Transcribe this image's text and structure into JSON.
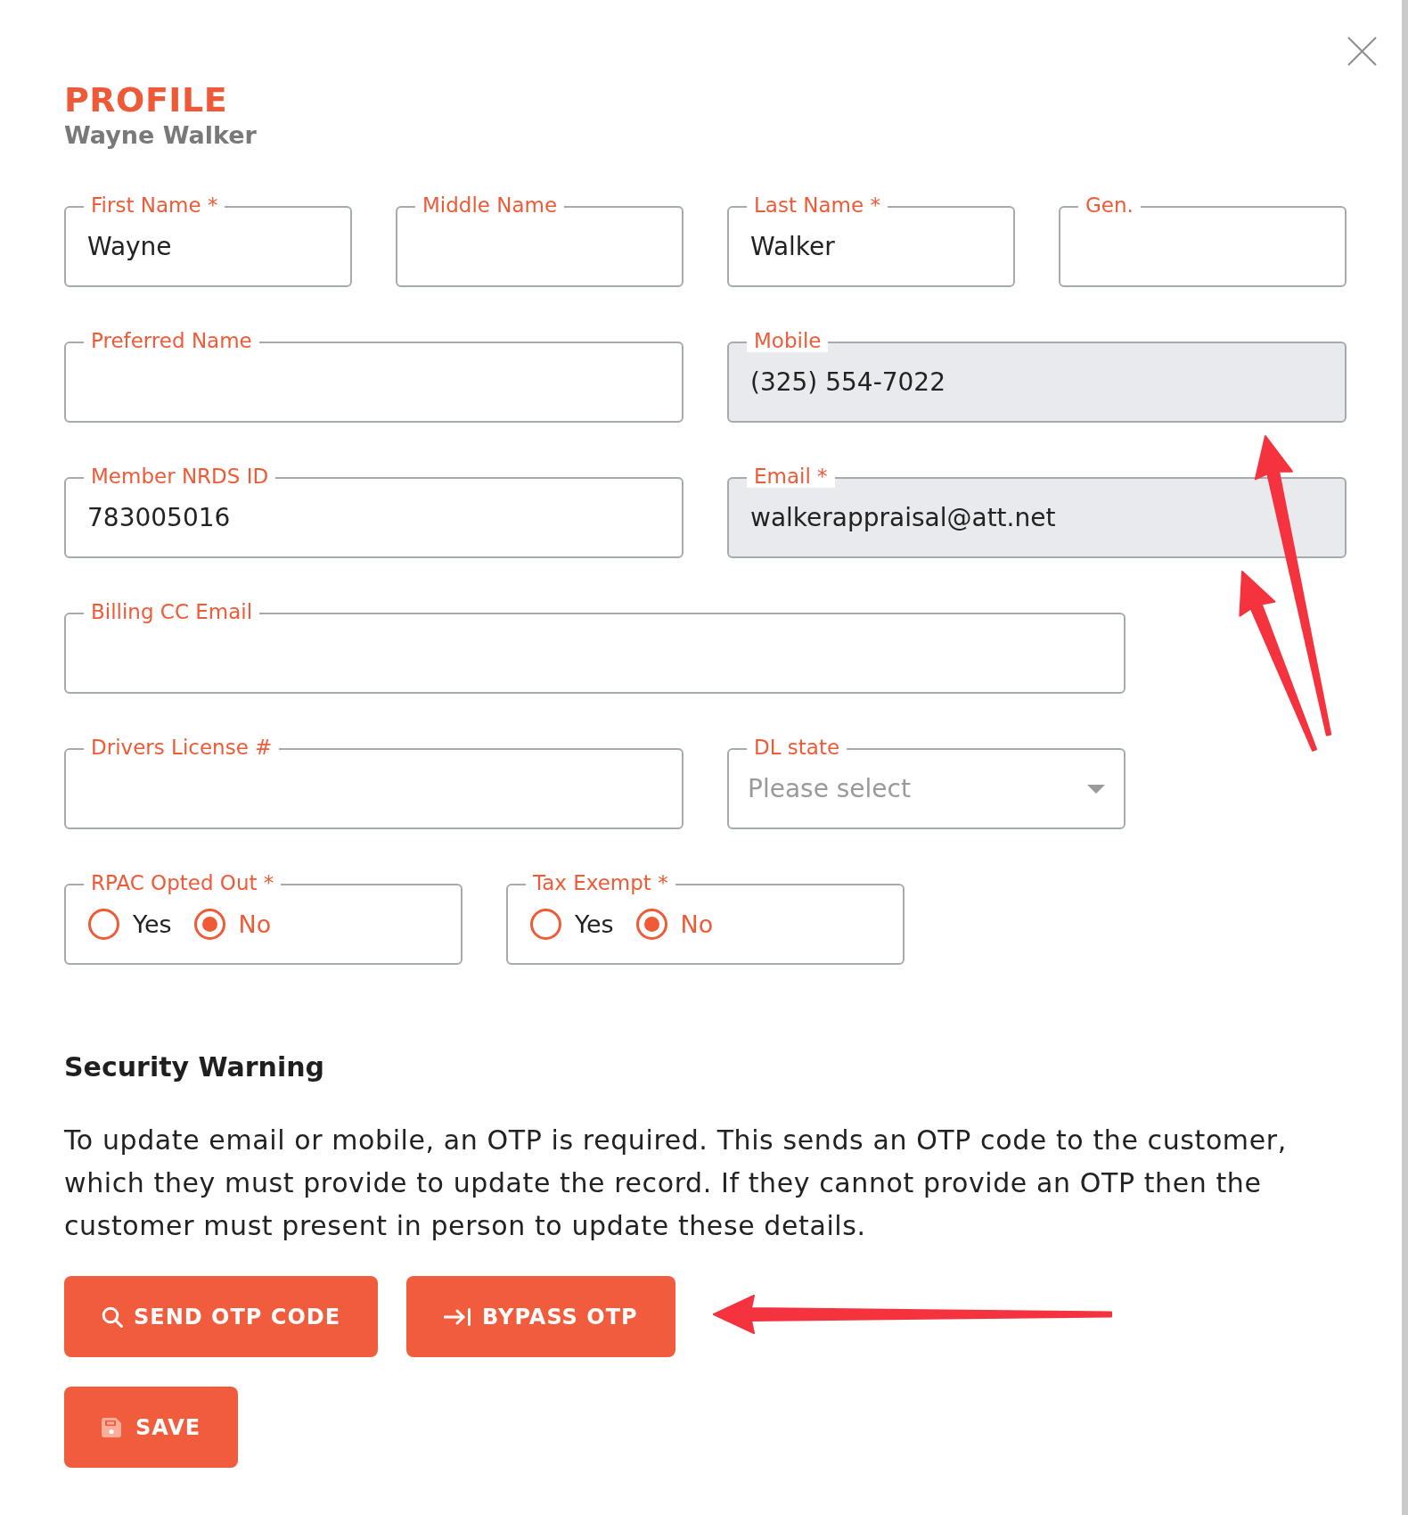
{
  "header": {
    "title": "PROFILE",
    "subtitle": "Wayne Walker"
  },
  "form_rows": [
    {
      "fields": [
        {
          "kind": "text",
          "label": "First Name *",
          "value": "Wayne",
          "disabled": false
        },
        {
          "kind": "text",
          "label": "Middle Name",
          "disabled": false
        },
        {
          "kind": "text",
          "label": "Last Name *",
          "value": "Walker",
          "disabled": false
        },
        {
          "kind": "text",
          "label": "Gen.",
          "disabled": false
        }
      ]
    },
    {
      "fields": [
        {
          "kind": "text",
          "label": "Preferred Name",
          "disabled": false
        },
        {
          "kind": "text",
          "label": "Mobile",
          "value": "(325) 554-7022",
          "disabled": true
        }
      ]
    },
    {
      "fields": [
        {
          "kind": "text",
          "label": "Member NRDS ID",
          "value": "783005016",
          "disabled": false
        },
        {
          "kind": "text",
          "label": "Email *",
          "value": "walkerappraisal@att.net",
          "disabled": true
        }
      ]
    },
    {
      "fields": [
        {
          "kind": "text",
          "label": "Billing CC Email",
          "disabled": false
        }
      ]
    },
    {
      "fields": [
        {
          "kind": "text",
          "label": "Drivers License #",
          "disabled": false
        },
        {
          "kind": "select",
          "label": "DL state",
          "placeholder": "Please select",
          "disabled": false
        }
      ]
    },
    {
      "fields": [
        {
          "kind": "radio",
          "label": "RPAC Opted Out *",
          "options": [
            {
              "label": "Yes",
              "selected": false
            },
            {
              "label": "No",
              "selected": true
            }
          ]
        },
        {
          "kind": "radio",
          "label": "Tax Exempt *",
          "options": [
            {
              "label": "Yes",
              "selected": false
            },
            {
              "label": "No",
              "selected": true
            }
          ]
        }
      ]
    }
  ],
  "security_warning": {
    "title": "Security Warning",
    "text": "To update email or mobile, an OTP is required. This sends an OTP code to the customer, which they must provide to update the record. If they cannot provide an OTP then the customer must present in person to update these details."
  },
  "otp_actions": [
    {
      "kind": "send",
      "label": "SEND OTP CODE"
    },
    {
      "kind": "bypass",
      "label": "BYPASS OTP"
    }
  ],
  "save_button": {
    "label": "SAVE"
  }
}
